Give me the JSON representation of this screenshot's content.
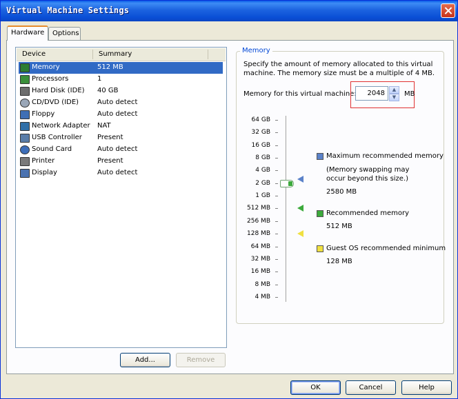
{
  "window": {
    "title": "Virtual Machine Settings"
  },
  "tabs": [
    {
      "label": "Hardware"
    },
    {
      "label": "Options"
    }
  ],
  "device_list": {
    "columns": [
      "Device",
      "Summary"
    ],
    "rows": [
      {
        "device": "Memory",
        "summary": "512 MB",
        "icon": "memory-icon"
      },
      {
        "device": "Processors",
        "summary": "1",
        "icon": "processor-icon"
      },
      {
        "device": "Hard Disk (IDE)",
        "summary": "40 GB",
        "icon": "hard-disk-icon"
      },
      {
        "device": "CD/DVD (IDE)",
        "summary": "Auto detect",
        "icon": "cd-dvd-icon"
      },
      {
        "device": "Floppy",
        "summary": "Auto detect",
        "icon": "floppy-icon"
      },
      {
        "device": "Network Adapter",
        "summary": "NAT",
        "icon": "network-adapter-icon"
      },
      {
        "device": "USB Controller",
        "summary": "Present",
        "icon": "usb-icon"
      },
      {
        "device": "Sound Card",
        "summary": "Auto detect",
        "icon": "sound-card-icon"
      },
      {
        "device": "Printer",
        "summary": "Present",
        "icon": "printer-icon"
      },
      {
        "device": "Display",
        "summary": "Auto detect",
        "icon": "display-icon"
      }
    ],
    "selected_index": 0
  },
  "list_buttons": {
    "add": "Add...",
    "remove": "Remove"
  },
  "memory": {
    "group_title": "Memory",
    "description": "Specify the amount of memory allocated to this virtual machine. The memory size must be a multiple of 4 MB.",
    "field_label": "Memory for this virtual machine:",
    "value": "2048",
    "unit": "MB",
    "scale": [
      "64 GB",
      "32 GB",
      "16 GB",
      "8 GB",
      "4 GB",
      "2 GB",
      "1 GB",
      "512 MB",
      "256 MB",
      "128 MB",
      "64 MB",
      "32 MB",
      "16 MB",
      "8 MB",
      "4 MB"
    ],
    "slider_value_mb": 2048,
    "markers": {
      "max_recommended_mb": 2580,
      "recommended_mb": 512,
      "guest_min_mb": 128
    },
    "legend": {
      "max_title": "Maximum recommended memory",
      "max_note": "(Memory swapping may occur beyond this size.)",
      "max_value": "2580 MB",
      "rec_title": "Recommended memory",
      "rec_value": "512 MB",
      "min_title": "Guest OS recommended minimum",
      "min_value": "128 MB"
    },
    "colors": {
      "max": "#5b82c9",
      "rec": "#3caa3c",
      "min": "#f0e040"
    }
  },
  "footer_buttons": {
    "ok": "OK",
    "cancel": "Cancel",
    "help": "Help"
  }
}
